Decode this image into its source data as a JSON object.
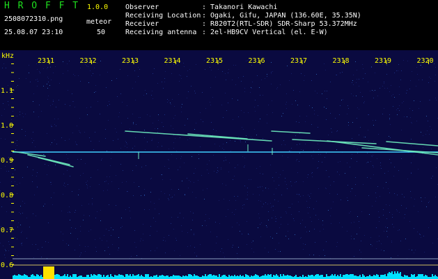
{
  "header": {
    "app_name": "H R O F F T",
    "version": "1.0.0",
    "filename": "2508072310.png",
    "datetime": "25.08.07 23:10",
    "mode_label": "meteor",
    "count": "50",
    "info": [
      {
        "label": "Observer",
        "value": ": Takanori Kawachi"
      },
      {
        "label": "Receiving Location",
        "value": ": Ogaki, Gifu, JAPAN (136.60E, 35.35N)"
      },
      {
        "label": "Receiver",
        "value": ": R820T2(RTL-SDR) SDR-Sharp 53.372MHz"
      },
      {
        "label": "Receiving antenna",
        "value": ": 2el-HB9CV Vertical (el. E-W)"
      }
    ]
  },
  "spectrogram": {
    "y_unit": "kHz",
    "y_ticks": [
      "1.1",
      "1.0",
      "0.9",
      "0.8",
      "0.7",
      "0.6"
    ],
    "y_tick_values": [
      1.1,
      1.0,
      0.9,
      0.8,
      0.7,
      0.6
    ],
    "y_range": [
      0.6,
      1.15
    ],
    "x_ticks": [
      "2311",
      "2312",
      "2313",
      "2314",
      "2315",
      "2316",
      "2317",
      "2318",
      "2319",
      "2320"
    ],
    "colors": {
      "background": "#0a0a40",
      "tick": "#ffff00",
      "carrier": "#3fd0ff",
      "echo": "#6ff0c0",
      "baseline": "#00e0ff"
    }
  }
}
